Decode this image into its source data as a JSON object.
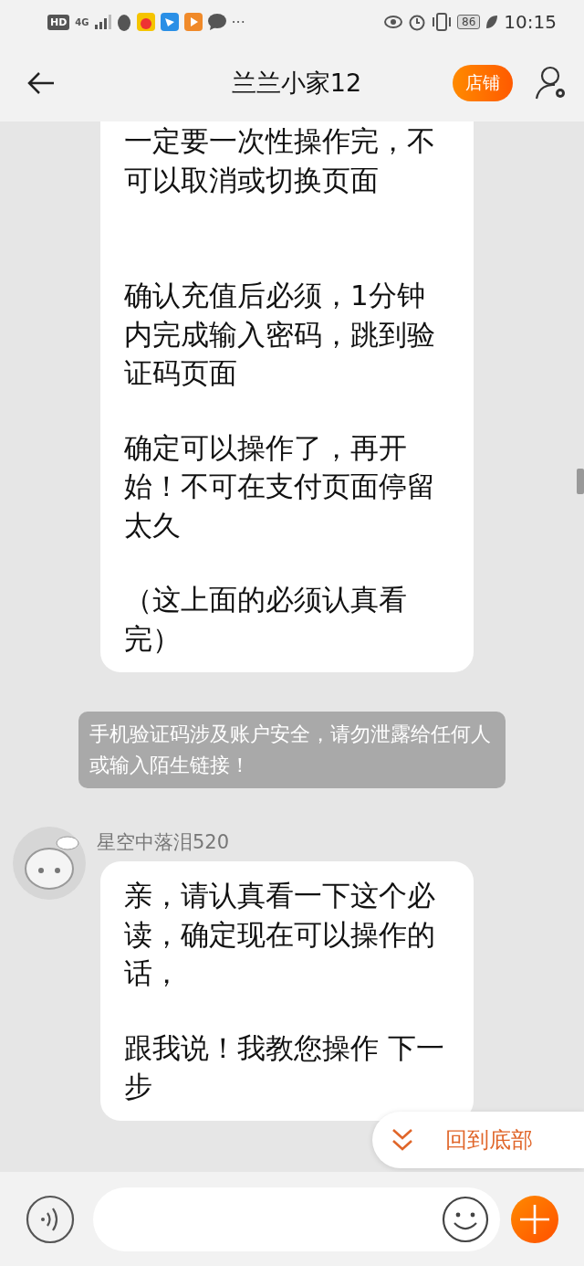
{
  "status_bar": {
    "network_badge": "HD",
    "network_type": "4G",
    "more": "···",
    "battery": "86",
    "time": "10:15"
  },
  "header": {
    "title": "兰兰小家12",
    "shop_button": "店铺"
  },
  "messages": [
    {
      "kind": "bubble",
      "paragraphs": [
        "一定要一次性操作完，不可以取消或切换页面",
        "确认充值后必须，1分钟内完成输入密码，跳到验证码页面",
        "确定可以操作了，再开始！不可在支付页面停留太久",
        "（这上面的必须认真看完）"
      ]
    },
    {
      "kind": "notice",
      "text": "手机验证码涉及账户安全，请勿泄露给任何人或输入陌生链接！"
    },
    {
      "kind": "incoming",
      "sender": "星空中落泪520",
      "paragraphs": [
        "亲，请认真看一下这个必读，确定现在可以操作的话，",
        "跟我说！我教您操作 下一步"
      ]
    }
  ],
  "scroll_button": {
    "label": "回到底部"
  }
}
